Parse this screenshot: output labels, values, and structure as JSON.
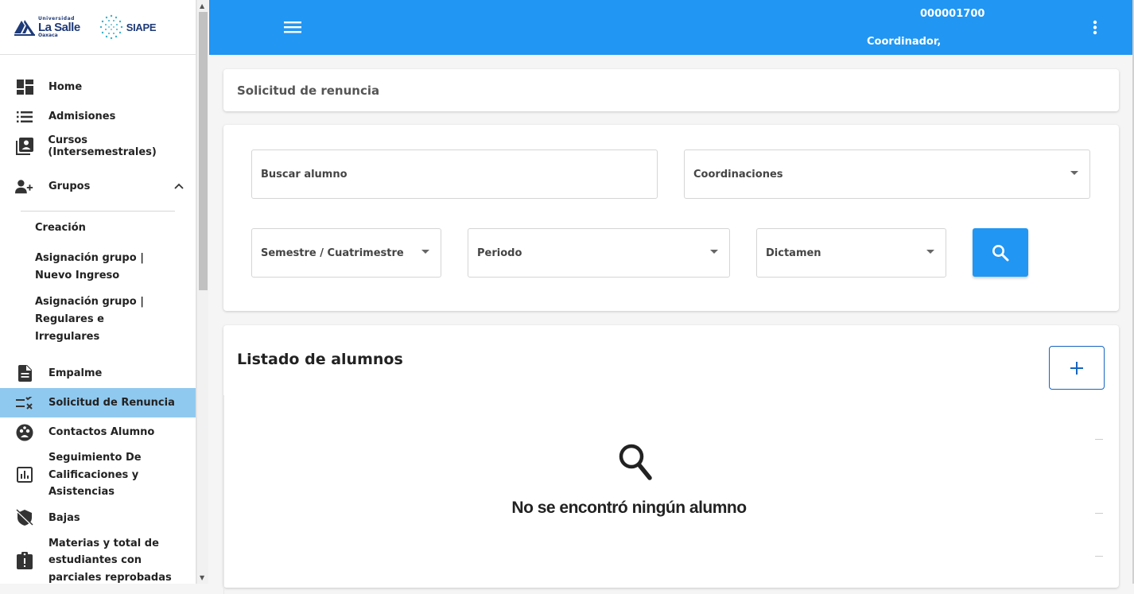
{
  "brand": {
    "university_top": "Universidad",
    "university_name": "La Salle",
    "university_city": "Oaxaca",
    "system_name": "SIAPE"
  },
  "sidebar": {
    "items": [
      {
        "label": "Home",
        "icon": "dashboard-icon"
      },
      {
        "label": "Admisiones",
        "icon": "list-icon"
      },
      {
        "label": "Cursos (Intersemestrales)",
        "icon": "contact-book-icon"
      },
      {
        "label": "Grupos",
        "icon": "person-add-icon",
        "expanded": true
      },
      {
        "label": "Empalme",
        "icon": "document-icon"
      },
      {
        "label": "Solicitud de Renuncia",
        "icon": "rule-icon",
        "active": true
      },
      {
        "label": "Contactos Alumno",
        "icon": "group-circle-icon"
      },
      {
        "label": "Seguimiento De Calificaciones y Asistencias",
        "icon": "chart-box-icon"
      },
      {
        "label": "Bajas",
        "icon": "shield-off-icon"
      },
      {
        "label": "Materias y total de estudiantes con parciales reprobadas",
        "icon": "clipboard-alert-icon"
      }
    ],
    "sub_items": [
      {
        "label": "Creación"
      },
      {
        "label": "Asignación grupo | Nuevo Ingreso"
      },
      {
        "label": "Asignación grupo | Regulares e Irregulares"
      }
    ]
  },
  "topbar": {
    "user_id": "000001700",
    "user_role": "Coordinador,",
    "color": "#2196f3"
  },
  "page": {
    "title": "Solicitud de renuncia"
  },
  "filters": {
    "search_placeholder": "Buscar alumno",
    "coordinaciones": "Coordinaciones",
    "semestre": "Semestre / Cuatrimestre",
    "periodo": "Periodo",
    "dictamen": "Dictamen"
  },
  "list": {
    "title": "Listado de alumnos",
    "empty_message": "No se encontró ningún alumno"
  },
  "colors": {
    "accent": "#2196f3",
    "active_item": "#90c9ef",
    "brand_navy": "#1e3a78"
  }
}
